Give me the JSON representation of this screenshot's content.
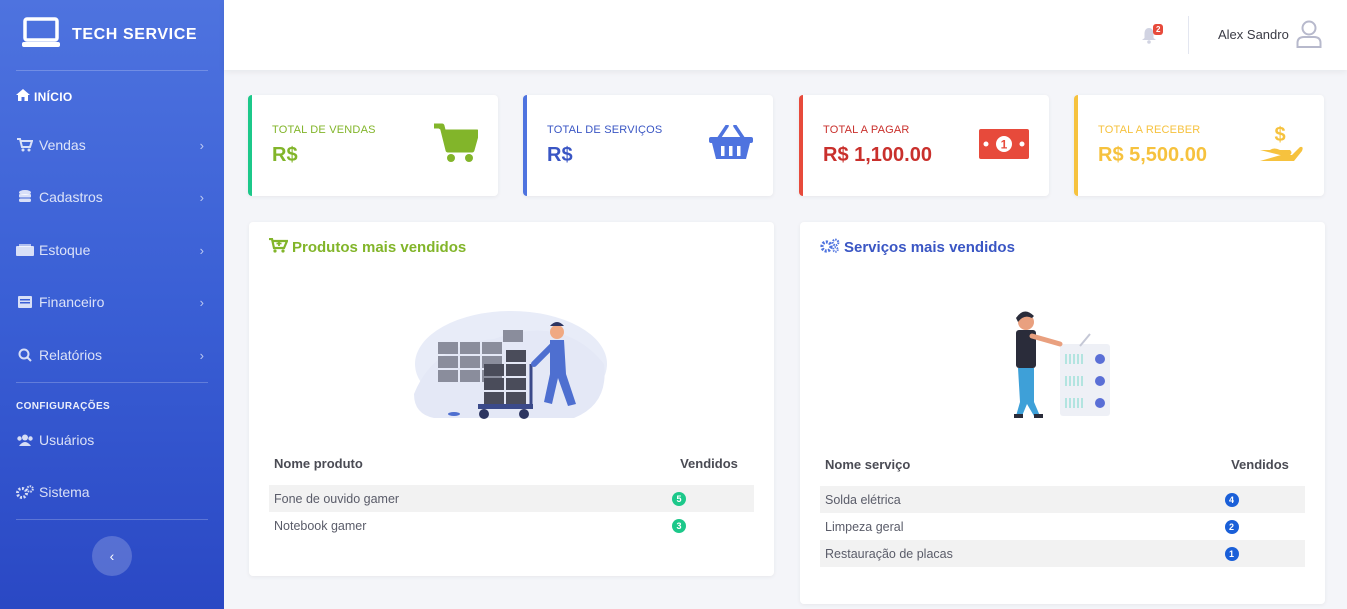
{
  "brand": {
    "title": "TECH SERVICE",
    "icon": "laptop-icon"
  },
  "sidebar": {
    "home_label": "INÍCIO",
    "items": [
      {
        "label": "Vendas",
        "icon": "cart-icon"
      },
      {
        "label": "Cadastros",
        "icon": "database-icon"
      },
      {
        "label": "Estoque",
        "icon": "box-icon"
      },
      {
        "label": "Financeiro",
        "icon": "money-icon"
      },
      {
        "label": "Relatórios",
        "icon": "search-icon"
      }
    ],
    "config_label": "CONFIGURAÇÕES",
    "config_items": [
      {
        "label": "Usuários",
        "icon": "users-icon"
      },
      {
        "label": "Sistema",
        "icon": "cogs-icon"
      }
    ],
    "toggle_symbol": "‹"
  },
  "topbar": {
    "notification_count": "2",
    "user_name": "Alex Sandro"
  },
  "stats": [
    {
      "label": "TOTAL DE VENDAS",
      "value": "R$",
      "color": "#1cc88a",
      "text_color": "#82b52a",
      "icon": "cart-icon"
    },
    {
      "label": "TOTAL DE SERVIÇOS",
      "value": "R$",
      "color": "#4e73df",
      "text_color": "#3a56c4",
      "icon": "basket-icon"
    },
    {
      "label": "TOTAL A PAGAR",
      "value": "R$ 1,100.00",
      "color": "#e74a3b",
      "text_color": "#c9302c",
      "icon": "money-bill-icon"
    },
    {
      "label": "TOTAL A RECEBER",
      "value": "R$ 5,500.00",
      "color": "#f6c23e",
      "text_color": "#f6c23e",
      "icon": "hand-coin-icon"
    }
  ],
  "products_panel": {
    "title": "Produtos mais vendidos",
    "col_name": "Nome produto",
    "col_sold": "Vendidos",
    "rows": [
      {
        "name": "Fone de ouvido gamer",
        "sold": "5"
      },
      {
        "name": "Notebook gamer",
        "sold": "3"
      }
    ],
    "badge_color": "#1cc88a"
  },
  "services_panel": {
    "title": "Serviços mais vendidos",
    "col_name": "Nome serviço",
    "col_sold": "Vendidos",
    "rows": [
      {
        "name": "Solda elétrica",
        "sold": "4"
      },
      {
        "name": "Limpeza geral",
        "sold": "2"
      },
      {
        "name": "Restauração de placas",
        "sold": "1"
      }
    ],
    "badge_color": "#1a5fd8"
  }
}
